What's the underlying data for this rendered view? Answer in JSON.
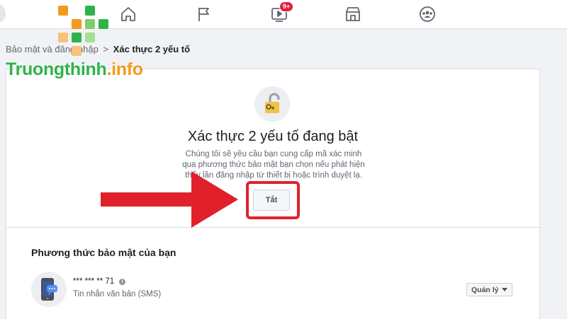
{
  "nav": {
    "icons": [
      "home-icon",
      "flag-icon",
      "watch-icon",
      "marketplace-icon",
      "groups-icon"
    ],
    "watch_badge": "9+"
  },
  "breadcrumb": {
    "parent": "Bảo mật và đăng nhập",
    "separator": ">",
    "current": "Xác thực 2 yếu tố"
  },
  "watermark": {
    "text_green": "Truongthinh",
    "text_orange": ".info",
    "colors": {
      "green": "#2db34a",
      "orange": "#f39a1e"
    }
  },
  "status_panel": {
    "icon": "unlocked-padlock-icon",
    "headline": "Xác thực 2 yếu tố đang bật",
    "description": "Chúng tôi sẽ yêu cầu bạn cung cấp mã xác minh qua phương thức bảo mật bạn chọn nếu phát hiện thấy lần đăng nhập từ thiết bị hoặc trình duyệt lạ.",
    "off_button_label": "Tắt"
  },
  "security_methods": {
    "section_title": "Phương thức bảo mật của bạn",
    "items": [
      {
        "icon": "phone-sms-icon",
        "masked_number": "*** *** ** 71",
        "type": "Tin nhắn văn bản (SMS)",
        "manage_label": "Quản lý"
      }
    ]
  },
  "annotation": {
    "arrow_color": "#e0212b",
    "highlight_color": "#e0212b"
  }
}
